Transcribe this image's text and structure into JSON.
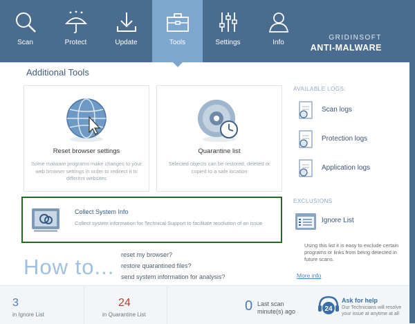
{
  "nav": {
    "items": [
      {
        "label": "Scan",
        "icon": "magnifier-icon"
      },
      {
        "label": "Protect",
        "icon": "umbrella-icon"
      },
      {
        "label": "Update",
        "icon": "download-icon"
      },
      {
        "label": "Tools",
        "icon": "toolbox-icon",
        "active": true
      },
      {
        "label": "Settings",
        "icon": "sliders-icon"
      },
      {
        "label": "Info",
        "icon": "person-icon"
      }
    ]
  },
  "brand": {
    "line1": "GRIDINSOFT",
    "line2": "ANTI-MALWARE"
  },
  "main": {
    "title": "Additional Tools",
    "cards": [
      {
        "title": "Reset browser settings",
        "desc": "Some malware programs make changes to your web browser settings in order to redirect it to different websites"
      },
      {
        "title": "Quarantine list",
        "desc": "Selected objects can be restored, deleted or copied to a safe location"
      }
    ],
    "sysinfo": {
      "title": "Collect System Info",
      "desc": "Collect system information for Technical Support to facilitate resolution of an issue"
    }
  },
  "howto": {
    "label": "How to...",
    "links": [
      "reset my browser?",
      "restore quarantined files?",
      "send system information for analysis?"
    ]
  },
  "side": {
    "logs_heading": "AVAILABLE LOGS:",
    "logs": [
      "Scan logs",
      "Protection logs",
      "Application logs"
    ],
    "exclusions_heading": "EXCLUSIONS",
    "ignore_label": "Ignore List",
    "ignore_desc": "Using this list it is easy to exclude certain programs or links from being detected in future scans.",
    "more_info": "More info"
  },
  "status": {
    "ignore_count": "3",
    "ignore_label": "in Ignore List",
    "quarantine_count": "24",
    "quarantine_label": "in Quarantine List",
    "last_scan_value": "0",
    "last_scan_label": "Last scan",
    "last_scan_unit": "minute(s) ago",
    "help_title": "Ask for help",
    "help_desc": "Our Technicians will resolve your issue at anytime at all",
    "help_badge": "24",
    "colors": {
      "quarantine": "#c0392b",
      "ignore": "#4a7ab0",
      "help": "#3a6ea5"
    }
  }
}
